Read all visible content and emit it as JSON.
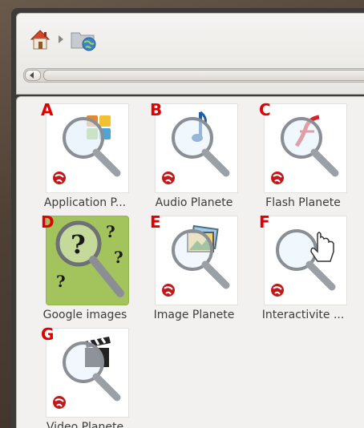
{
  "window": {
    "breadcrumbs": [
      {
        "icon": "home-folder-icon",
        "label": ""
      },
      {
        "icon": "web-folder-icon",
        "label": ""
      }
    ]
  },
  "files": [
    {
      "letter": "A",
      "label": "Application P...",
      "icon": "application-planete-icon"
    },
    {
      "letter": "B",
      "label": "Audio Planete",
      "icon": "audio-planete-icon"
    },
    {
      "letter": "C",
      "label": "Flash Planete",
      "icon": "flash-planete-icon"
    },
    {
      "letter": "D",
      "label": "Google images",
      "icon": "google-images-icon"
    },
    {
      "letter": "E",
      "label": "Image Planete",
      "icon": "image-planete-icon"
    },
    {
      "letter": "F",
      "label": "Interactivite ...",
      "icon": "interactivite-planete-icon"
    },
    {
      "letter": "G",
      "label": "Video Planete",
      "icon": "video-planete-icon"
    }
  ],
  "colors": {
    "annotation_letter": "#e00000",
    "content_bg": "#f2f1f0",
    "google_tile": "#a3c45c",
    "globe_red": "#c0191b"
  }
}
